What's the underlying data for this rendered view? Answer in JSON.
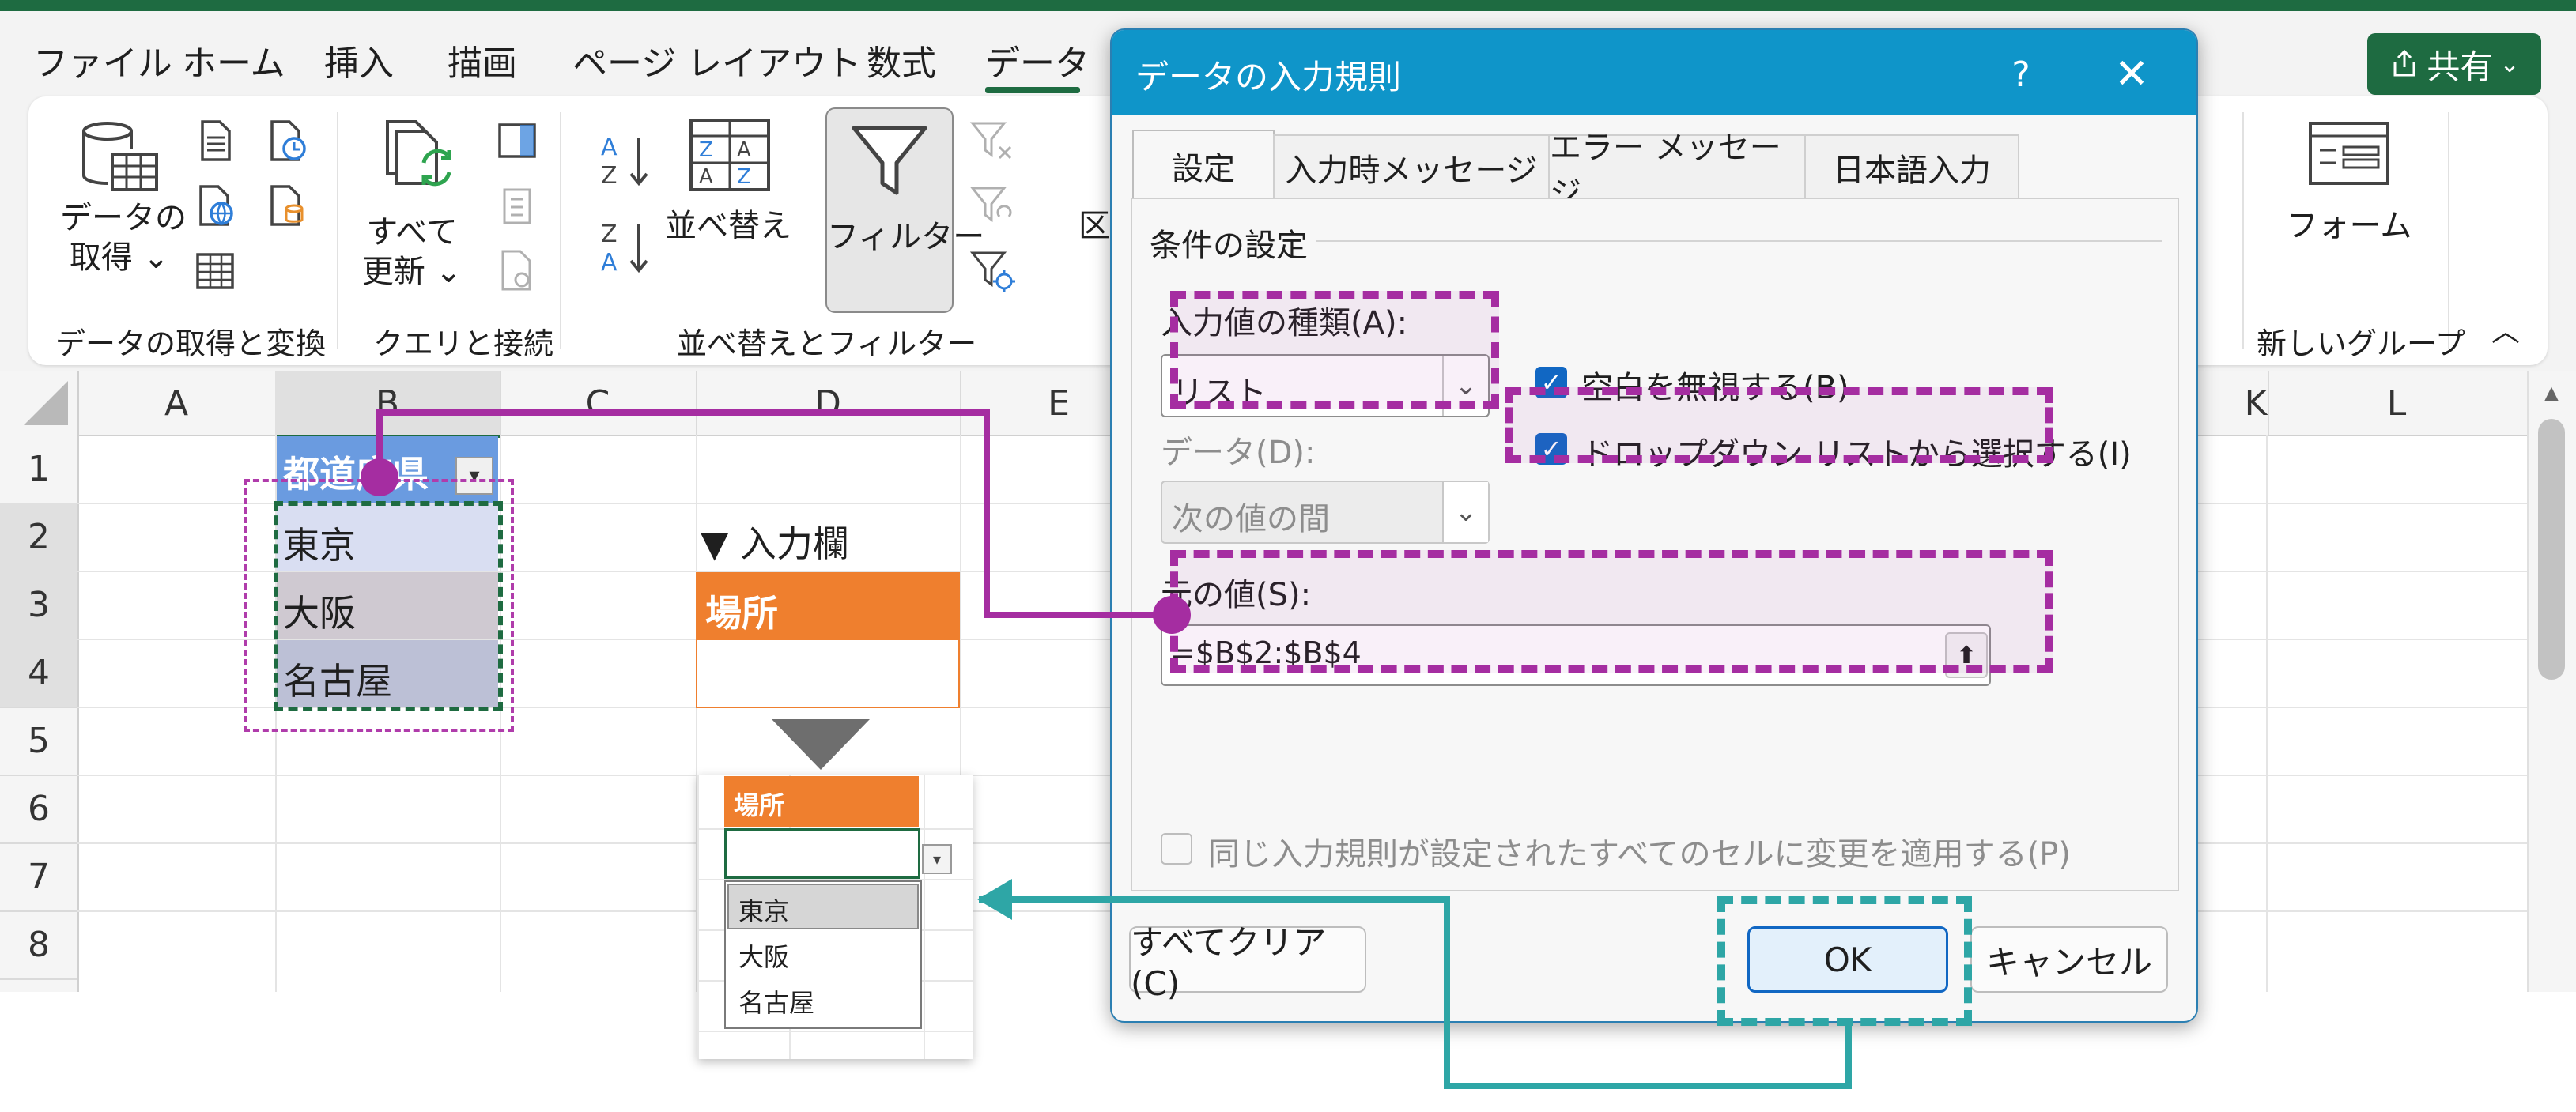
{
  "menu": {
    "items": [
      "ファイル",
      "ホーム",
      "挿入",
      "描画",
      "ページ レイアウト",
      "数式",
      "データ"
    ],
    "active": "データ",
    "share_label": "共有"
  },
  "ribbon": {
    "get_data_label1": "データの",
    "get_data_label2": "取得",
    "refresh_label1": "すべて",
    "refresh_label2": "更新",
    "sort_label": "並べ替え",
    "filter_label": "フィルター",
    "cut_label": "区",
    "form_label": "フォーム",
    "groups": {
      "get_transform": "データの取得と変換",
      "queries": "クエリと接続",
      "sort_filter": "並べ替えとフィルター",
      "new_group": "新しいグループ"
    }
  },
  "sheet": {
    "columns": [
      "A",
      "B",
      "C",
      "D",
      "E",
      "K",
      "L"
    ],
    "rows": [
      "1",
      "2",
      "3",
      "4",
      "5",
      "6",
      "7",
      "8"
    ],
    "b1_header": "都道府県",
    "list_values": [
      "東京",
      "大阪",
      "名古屋"
    ],
    "input_title": "▼ 入力欄",
    "input_header": "場所"
  },
  "popup": {
    "header": "場所",
    "options": [
      "東京",
      "大阪",
      "名古屋"
    ]
  },
  "dialog": {
    "title": "データの入力規則",
    "help": "?",
    "close": "✕",
    "tabs": [
      "設定",
      "入力時メッセージ",
      "エラー メッセージ",
      "日本語入力"
    ],
    "section": "条件の設定",
    "allow_label": "入力値の種類(A):",
    "allow_value": "リスト",
    "ignore_blank": "空白を無視する(B)",
    "dropdown": "ドロップダウン リストから選択する(I)",
    "data_label": "データ(D):",
    "data_value": "次の値の間",
    "source_label": "元の値(S):",
    "source_value": "=$B$2:$B$4",
    "apply_all": "同じ入力規則が設定されたすべてのセルに変更を適用する(P)",
    "clear_all": "すべてクリア(C)",
    "ok": "OK",
    "cancel": "キャンセル"
  },
  "colors": {
    "excel_green": "#1e6b41",
    "dialog_title": "#0f95c9",
    "annotation_magenta": "#a52da1",
    "annotation_teal": "#2ea6a6",
    "input_orange": "#ef7f2e",
    "list_blue": "#6a9be0"
  }
}
